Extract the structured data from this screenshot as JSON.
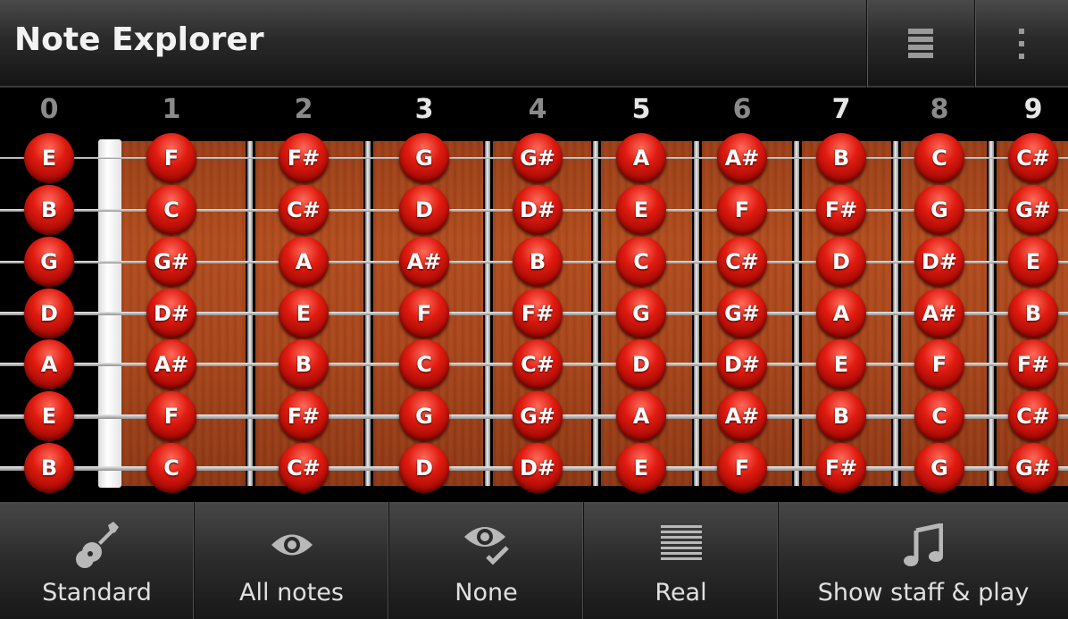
{
  "app": {
    "title": "Note Explorer"
  },
  "action_icons": [
    "list-icon",
    "overflow-icon"
  ],
  "fretboard": {
    "fret_numbers": [
      "0",
      "1",
      "2",
      "3",
      "4",
      "5",
      "6",
      "7",
      "8",
      "9"
    ],
    "strings": [
      [
        "E",
        "F",
        "F#",
        "G",
        "G#",
        "A",
        "A#",
        "B",
        "C",
        "C#"
      ],
      [
        "B",
        "C",
        "C#",
        "D",
        "D#",
        "E",
        "F",
        "F#",
        "G",
        "G#"
      ],
      [
        "G",
        "G#",
        "A",
        "A#",
        "B",
        "C",
        "C#",
        "D",
        "D#",
        "E"
      ],
      [
        "D",
        "D#",
        "E",
        "F",
        "F#",
        "G",
        "G#",
        "A",
        "A#",
        "B"
      ],
      [
        "A",
        "A#",
        "B",
        "C",
        "C#",
        "D",
        "D#",
        "E",
        "F",
        "F#"
      ],
      [
        "E",
        "F",
        "F#",
        "G",
        "G#",
        "A",
        "A#",
        "B",
        "C",
        "C#"
      ],
      [
        "B",
        "C",
        "C#",
        "D",
        "D#",
        "E",
        "F",
        "F#",
        "G",
        "G#"
      ]
    ]
  },
  "toolbar": {
    "buttons": [
      {
        "label": "Standard",
        "icon": "guitar-icon"
      },
      {
        "label": "All notes",
        "icon": "eye-icon"
      },
      {
        "label": "None",
        "icon": "eye-check-icon"
      },
      {
        "label": "Real",
        "icon": "staff-lines-icon"
      },
      {
        "label": "Show staff & play",
        "icon": "music-note-icon"
      }
    ]
  },
  "colors": {
    "note": "#d21409",
    "wood": "#a9461b",
    "bar_bg": "#2b2b2b",
    "text": "#e0e0e0"
  }
}
